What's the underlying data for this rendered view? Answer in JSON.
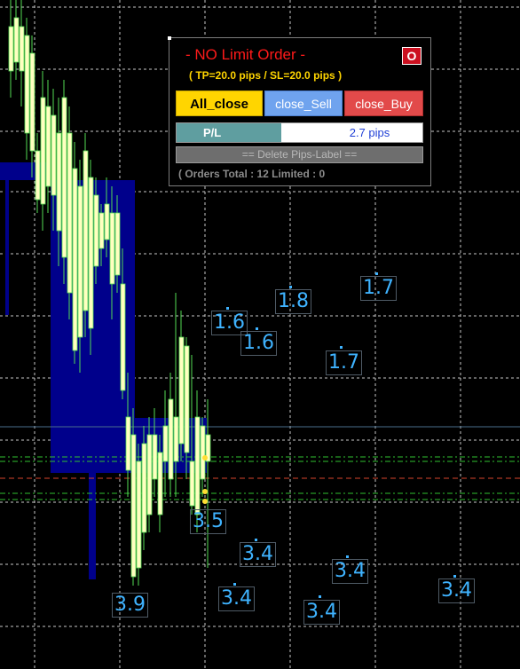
{
  "panel": {
    "title": "- NO Limit Order -",
    "close_label": "O",
    "subtitle": "( TP=20.0 pips / SL=20.0 pips )",
    "all_close_label": "All_close",
    "close_sell_label": "close_Sell",
    "close_buy_label": "close_Buy",
    "pl_label": "P/L",
    "pl_value": "2.7 pips",
    "delete_label": "== Delete Pips-Label ==",
    "status": "( Orders Total : 12  Limited : 0"
  },
  "pip_labels": {
    "l1": "1.8",
    "l2": "1.7",
    "l3": "1.6",
    "l4": "1.6",
    "l5": "1.7",
    "l6": "3.5",
    "l7": "3.4",
    "l8": "3.4",
    "l9": "3.9",
    "l10": "3.4",
    "l11": "3.4",
    "l12": "3.4"
  },
  "colors": {
    "background": "#000000",
    "grid": "#c8c8c8",
    "bull_candle": "#ffffc0",
    "wick": "#55dd55",
    "zone": "#00008b",
    "pip_label": "#3fb3ff"
  }
}
